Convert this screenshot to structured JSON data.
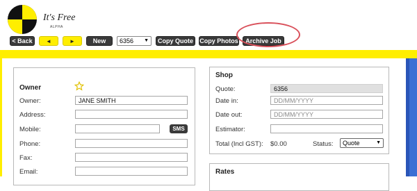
{
  "logo": {
    "title": "It's Free",
    "subtitle": "ALPHA"
  },
  "toolbar": {
    "back_label": "< Back",
    "prev_label": "◄",
    "next_label": "►",
    "new_label": "New",
    "job_select_value": "6356",
    "copy_quote_label": "Copy Quote",
    "copy_photos_label": "Copy Photos",
    "archive_job_label": "Archive Job"
  },
  "owner": {
    "title": "Owner",
    "owner_label": "Owner:",
    "owner_value": "JANE SMITH",
    "address_label": "Address:",
    "mobile_label": "Mobile:",
    "sms_label": "SMS",
    "phone_label": "Phone:",
    "fax_label": "Fax:",
    "email_label": "Email:"
  },
  "shop": {
    "title": "Shop",
    "quote_label": "Quote:",
    "quote_value": "6356",
    "date_in_label": "Date in:",
    "date_in_placeholder": "DD/MM/YYYY",
    "date_out_label": "Date out:",
    "date_out_placeholder": "DD/MM/YYYY",
    "estimator_label": "Estimator:",
    "total_label": "Total (Incl GST):",
    "total_value": "$0.00",
    "status_label": "Status:",
    "status_value": "Quote"
  },
  "rates": {
    "title": "Rates"
  },
  "colors": {
    "accent_yellow": "#ffee00",
    "dark_button": "#3a3a3a",
    "annotation_red": "#d9505a",
    "side_blue": "#3b6fd4"
  }
}
